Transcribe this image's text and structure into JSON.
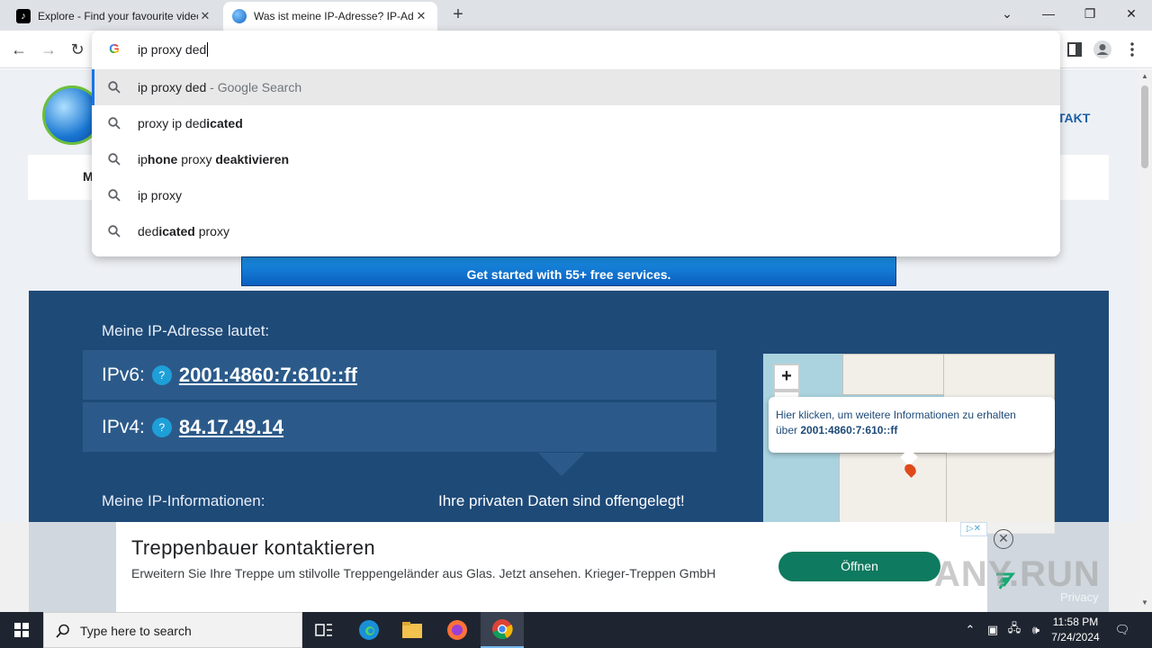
{
  "tabs": [
    {
      "title": "Explore - Find your favourite videos on TikTok",
      "active": false
    },
    {
      "title": "Was ist meine IP-Adresse? IP-Adresse",
      "active": true
    }
  ],
  "omnibox": {
    "value": "ip proxy ded",
    "suggestions": [
      {
        "plain1": "ip proxy ded",
        "bold1": "",
        "plain2": "",
        "bold2": "",
        "hint": " - Google Search"
      },
      {
        "plain1": "proxy ip ded",
        "bold1": "icated",
        "plain2": "",
        "bold2": "",
        "hint": ""
      },
      {
        "plain1": "ip",
        "bold1": "hone",
        "plain2": " proxy ",
        "bold2": "deaktivieren",
        "hint": ""
      },
      {
        "plain1": "ip proxy",
        "bold1": "",
        "plain2": "",
        "bold2": "",
        "hint": ""
      },
      {
        "plain1": "ded",
        "bold1": "icated",
        "plain2": " proxy",
        "bold2": "",
        "hint": ""
      }
    ]
  },
  "site": {
    "nav_partial": "TAKT",
    "nav_first_letter": "M",
    "banner_text": "Get started with 55+ free services.",
    "ip_label": "Meine IP-Adresse lautet:",
    "ipv6_key": "IPv6:",
    "ipv6_value": "2001:4860:7:610::ff",
    "ipv4_key": "IPv4:",
    "ipv4_value": "84.17.49.14",
    "help_glyph": "?",
    "info_label": "Meine IP-Informationen:",
    "private_notice": "Ihre privaten Daten sind offengelegt!",
    "map": {
      "zoom_in": "+",
      "zoom_out": "−",
      "popup_line1": "Hier klicken, um weitere Informationen zu erhalten",
      "popup_prefix": "über ",
      "popup_ip": "2001:4860:7:610::ff"
    }
  },
  "ad": {
    "title": "Treppenbauer kontaktieren",
    "description": "Erweitern Sie Ihre Treppe um stilvolle Treppengeländer aus Glas. Jetzt ansehen. Krieger-Treppen GmbH",
    "cta": "Öffnen",
    "privacy": "Privacy",
    "watermark": "ANY.RUN"
  },
  "taskbar": {
    "search_placeholder": "Type here to search",
    "time": "11:58 PM",
    "date": "7/24/2024"
  },
  "colors": {
    "ip_box": "#1e4a78",
    "ip_row": "#2b5a8a",
    "accent_blue": "#1a73e8",
    "ad_button": "#0e7a5f"
  }
}
